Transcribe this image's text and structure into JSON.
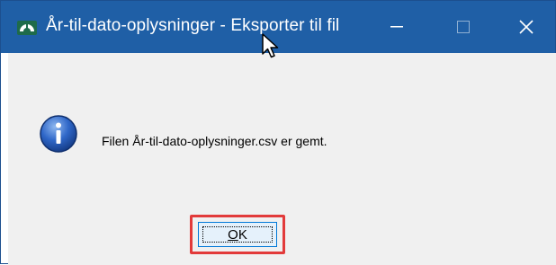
{
  "window": {
    "title": "År-til-dato-oplysninger - Eksporter til fil",
    "controls": {
      "minimize": "—",
      "maximize": "☐",
      "close": "✕"
    }
  },
  "dialog": {
    "icon": "info-icon",
    "message": "Filen År-til-dato-oplysninger.csv er gemt.",
    "ok_button": {
      "mnemonic": "O",
      "rest": "K"
    }
  },
  "colors": {
    "titlebar": "#1f5fa6",
    "content_bg": "#f0f0f0",
    "highlight": "#e23a3a"
  }
}
